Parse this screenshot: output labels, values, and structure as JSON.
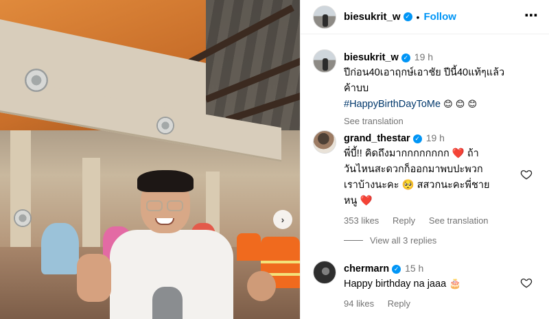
{
  "post": {
    "author": "biesukrit_w",
    "follow_label": "Follow",
    "more_icon": "⋯",
    "caption": {
      "username": "biesukrit_w",
      "time": "19 h",
      "line1": "ปีก่อน40เอาฤกษ์เอาชัย ปีนี้40แท้ๆแล้ว",
      "line2": "ค้าบบ",
      "hashtag": "#HappyBirthDayToMe",
      "emojis": "😊 😊 😊",
      "see_translation": "See translation"
    }
  },
  "comments": [
    {
      "username": "grand_thestar",
      "time": "19 h",
      "lines": [
        "พี่บี้!! คิดถึงมากกกกกกกก ❤️ ถ้า",
        "วันไหนสะดวกก็ออกมาพบปะพวก",
        "เราบ้างนะคะ 🥺 สสวกนะคะพี่ชาย",
        "หนู ❤️"
      ],
      "likes": "353 likes",
      "reply": "Reply",
      "see_translation": "See translation",
      "view_replies": "View all 3 replies"
    },
    {
      "username": "chermarn",
      "time": "15 h",
      "text": "Happy birthday na jaaa 🎂",
      "likes": "94 likes",
      "reply": "Reply"
    }
  ],
  "icons": {
    "verified": "verified-badge-icon",
    "heart": "heart-outline-icon",
    "next": "chevron-right-icon"
  },
  "colors": {
    "link_blue": "#0095f6",
    "hashtag": "#00376b",
    "muted": "#737373"
  }
}
